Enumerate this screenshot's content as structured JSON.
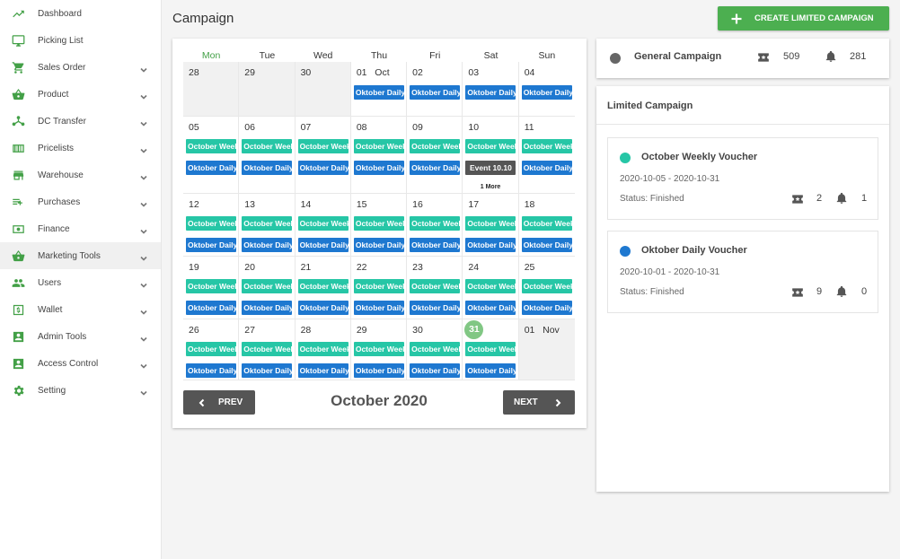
{
  "sidebar": {
    "items": [
      {
        "label": "Dashboard",
        "icon": "trending-up-icon",
        "chevron": false
      },
      {
        "label": "Picking List",
        "icon": "monitor-icon",
        "chevron": false
      },
      {
        "label": "Sales Order",
        "icon": "cart-icon",
        "chevron": true
      },
      {
        "label": "Product",
        "icon": "basket-icon",
        "chevron": true
      },
      {
        "label": "DC Transfer",
        "icon": "hierarchy-icon",
        "chevron": true
      },
      {
        "label": "Pricelists",
        "icon": "barcode-icon",
        "chevron": true
      },
      {
        "label": "Warehouse",
        "icon": "store-icon",
        "chevron": true
      },
      {
        "label": "Purchases",
        "icon": "playlist-add-icon",
        "chevron": true
      },
      {
        "label": "Finance",
        "icon": "money-icon",
        "chevron": true
      },
      {
        "label": "Marketing Tools",
        "icon": "basket-icon",
        "chevron": true
      },
      {
        "label": "Users",
        "icon": "users-icon",
        "chevron": true
      },
      {
        "label": "Wallet",
        "icon": "dollar-box-icon",
        "chevron": true
      },
      {
        "label": "Admin Tools",
        "icon": "account-box-icon",
        "chevron": true
      },
      {
        "label": "Access Control",
        "icon": "account-box-icon",
        "chevron": true
      },
      {
        "label": "Setting",
        "icon": "gear-icon",
        "chevron": true
      }
    ],
    "active_index": 9
  },
  "header": {
    "title": "Campaign",
    "create_button": "CREATE LIMITED CAMPAIGN"
  },
  "calendar": {
    "weekdays": [
      "Mon",
      "Tue",
      "Wed",
      "Thu",
      "Fri",
      "Sat",
      "Sun"
    ],
    "month_label": "October 2020",
    "prev_label": "PREV",
    "next_label": "NEXT",
    "weeks": [
      [
        {
          "n": "28",
          "other": true,
          "events": []
        },
        {
          "n": "29",
          "other": true,
          "events": []
        },
        {
          "n": "30",
          "other": true,
          "events": []
        },
        {
          "n": "01   Oct",
          "events": [
            "daily"
          ]
        },
        {
          "n": "02",
          "events": [
            "daily"
          ]
        },
        {
          "n": "03",
          "events": [
            "daily"
          ]
        },
        {
          "n": "04",
          "events": [
            "daily"
          ]
        }
      ],
      [
        {
          "n": "05",
          "events": [
            "weekly",
            "daily"
          ]
        },
        {
          "n": "06",
          "events": [
            "weekly",
            "daily"
          ]
        },
        {
          "n": "07",
          "events": [
            "weekly",
            "daily"
          ]
        },
        {
          "n": "08",
          "events": [
            "weekly",
            "daily"
          ]
        },
        {
          "n": "09",
          "events": [
            "weekly",
            "daily"
          ]
        },
        {
          "n": "10",
          "events": [
            "weekly",
            "special"
          ],
          "more": "1 More"
        },
        {
          "n": "11",
          "events": [
            "weekly",
            "daily"
          ]
        }
      ],
      [
        {
          "n": "12",
          "events": [
            "weekly",
            "daily"
          ]
        },
        {
          "n": "13",
          "events": [
            "weekly",
            "daily"
          ]
        },
        {
          "n": "14",
          "events": [
            "weekly",
            "daily"
          ]
        },
        {
          "n": "15",
          "events": [
            "weekly",
            "daily"
          ]
        },
        {
          "n": "16",
          "events": [
            "weekly",
            "daily"
          ]
        },
        {
          "n": "17",
          "events": [
            "weekly",
            "daily"
          ]
        },
        {
          "n": "18",
          "events": [
            "weekly",
            "daily"
          ]
        }
      ],
      [
        {
          "n": "19",
          "events": [
            "weekly",
            "daily"
          ]
        },
        {
          "n": "20",
          "events": [
            "weekly",
            "daily"
          ]
        },
        {
          "n": "21",
          "events": [
            "weekly",
            "daily"
          ]
        },
        {
          "n": "22",
          "events": [
            "weekly",
            "daily"
          ]
        },
        {
          "n": "23",
          "events": [
            "weekly",
            "daily"
          ]
        },
        {
          "n": "24",
          "events": [
            "weekly",
            "daily"
          ]
        },
        {
          "n": "25",
          "events": [
            "weekly",
            "daily"
          ]
        }
      ],
      [
        {
          "n": "26",
          "events": [
            "weekly",
            "daily"
          ]
        },
        {
          "n": "27",
          "events": [
            "weekly",
            "daily"
          ]
        },
        {
          "n": "28",
          "events": [
            "weekly",
            "daily"
          ]
        },
        {
          "n": "29",
          "events": [
            "weekly",
            "daily"
          ]
        },
        {
          "n": "30",
          "events": [
            "weekly",
            "daily"
          ]
        },
        {
          "n": "31",
          "today": true,
          "events": [
            "weekly",
            "daily"
          ]
        },
        {
          "n": "01   Nov",
          "other": true,
          "events": []
        }
      ]
    ],
    "event_labels": {
      "weekly": "October Weekly Voucher",
      "daily": "Oktober Daily Voucher",
      "special": "Event 10.10"
    }
  },
  "general_campaign": {
    "name": "General Campaign",
    "voucher_count": "509",
    "notification_count": "281"
  },
  "limited_campaign": {
    "title": "Limited Campaign",
    "items": [
      {
        "name": "October Weekly Voucher",
        "color": "#26c6a6",
        "dates": "2020-10-05 - 2020-10-31",
        "status": "Status: Finished",
        "voucher_count": "2",
        "notification_count": "1"
      },
      {
        "name": "Oktober Daily Voucher",
        "color": "#1e78d0",
        "dates": "2020-10-01 - 2020-10-31",
        "status": "Status: Finished",
        "voucher_count": "9",
        "notification_count": "0"
      }
    ]
  },
  "colors": {
    "accent": "#4caf50",
    "weekly_event": "#26c6a6",
    "daily_event": "#1e78d0",
    "special_event": "#555555",
    "today": "#81c784"
  }
}
